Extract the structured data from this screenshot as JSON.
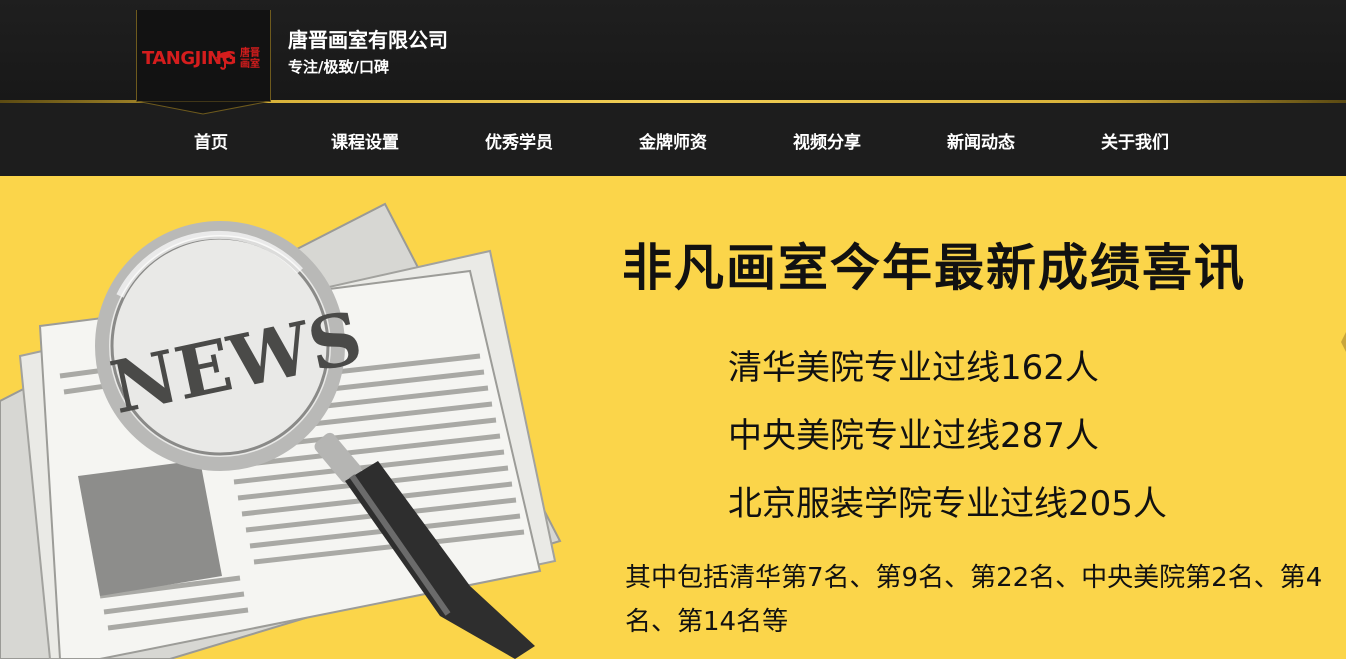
{
  "header": {
    "logo_text": "TANGJING",
    "logo_chinese": "唐晋画室",
    "company_name": "唐晋画室有限公司",
    "slogan": "专注/极致/口碑"
  },
  "nav": {
    "items": [
      {
        "label": "首页"
      },
      {
        "label": "课程设置"
      },
      {
        "label": "优秀学员"
      },
      {
        "label": "金牌师资"
      },
      {
        "label": "视频分享"
      },
      {
        "label": "新闻动态"
      },
      {
        "label": "关于我们"
      }
    ]
  },
  "banner": {
    "headline": "非凡画室今年最新成绩喜讯",
    "stats": [
      "清华美院专业过线162人",
      "中央美院专业过线287人",
      "北京服装学院专业过线205人"
    ],
    "detail": "其中包括清华第7名、第9名、第22名、中央美院第2名、第4名、第14名等",
    "illustration_text": "NEWS"
  },
  "colors": {
    "background": "#fbd54a",
    "header": "#1d1d1d",
    "accent_gold": "#d8b23a",
    "logo_red": "#d41d1d"
  }
}
